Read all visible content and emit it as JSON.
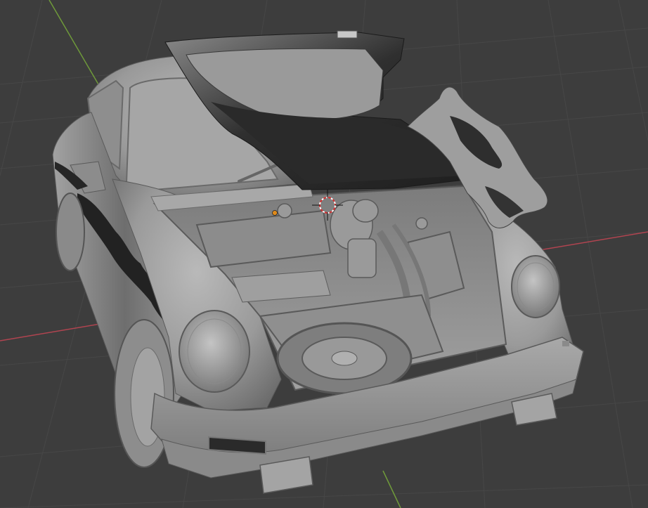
{
  "app": {
    "name": "",
    "view": "3D Viewport"
  },
  "viewport": {
    "background": "#3d3d3d",
    "grid_color": "#4a4a4a",
    "x_axis_color": "#b14450",
    "y_axis_color": "#6f9a3a",
    "shading": "solid",
    "scene_object": "car-model-open-hood"
  },
  "scene": {
    "cursor_3d": {
      "visible": true
    },
    "origin_point": {
      "visible": true,
      "color": "#e08a1a"
    }
  }
}
